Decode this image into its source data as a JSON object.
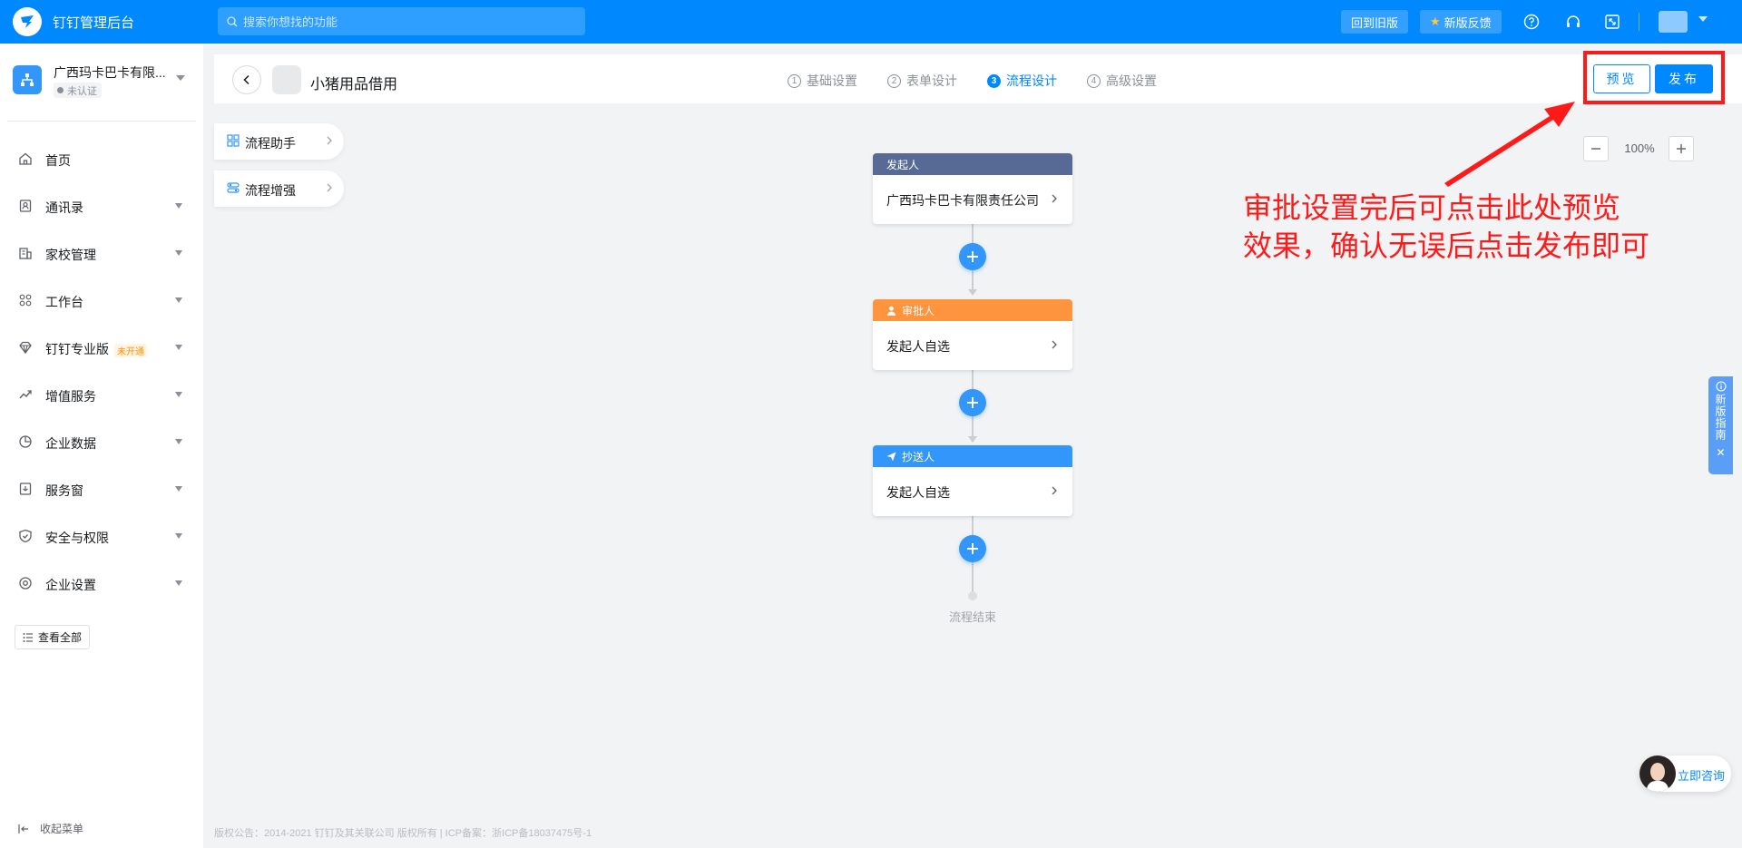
{
  "topbar": {
    "app_title": "钉钉管理后台",
    "search_placeholder": "搜索你想找的功能",
    "old_version_label": "回到旧版",
    "feedback_label": "新版反馈",
    "icons": [
      "help-icon",
      "headset-icon",
      "fullscreen-icon"
    ],
    "brand_color": "#0089ff"
  },
  "sidebar": {
    "org_name": "广西玛卡巴卡有限...",
    "org_status": "未认证",
    "items": [
      {
        "label": "首页",
        "icon": "home-icon",
        "has_caret": false
      },
      {
        "label": "通讯录",
        "icon": "contacts-icon",
        "has_caret": true
      },
      {
        "label": "家校管理",
        "icon": "school-icon",
        "has_caret": true
      },
      {
        "label": "工作台",
        "icon": "apps-icon",
        "has_caret": true
      },
      {
        "label": "钉钉专业版",
        "icon": "diamond-icon",
        "has_caret": true,
        "tag": "未开通"
      },
      {
        "label": "增值服务",
        "icon": "trend-icon",
        "has_caret": true
      },
      {
        "label": "企业数据",
        "icon": "chart-icon",
        "has_caret": true
      },
      {
        "label": "服务窗",
        "icon": "service-icon",
        "has_caret": true
      },
      {
        "label": "安全与权限",
        "icon": "shield-icon",
        "has_caret": true
      },
      {
        "label": "企业设置",
        "icon": "settings-icon",
        "has_caret": true
      }
    ],
    "view_all_label": "查看全部",
    "collapse_label": "收起菜单"
  },
  "header": {
    "form_title": "小猪用品借用",
    "steps": [
      {
        "num": "1",
        "label": "基础设置",
        "active": false
      },
      {
        "num": "2",
        "label": "表单设计",
        "active": false
      },
      {
        "num": "3",
        "label": "流程设计",
        "active": true
      },
      {
        "num": "4",
        "label": "高级设置",
        "active": false
      }
    ],
    "preview_label": "预览",
    "publish_label": "发布"
  },
  "helpers": [
    {
      "label": "流程助手",
      "icon": "grid-icon"
    },
    {
      "label": "流程增强",
      "icon": "toggle-icon"
    }
  ],
  "zoom": {
    "value": "100%"
  },
  "flow": {
    "nodes": [
      {
        "type": "initiator",
        "title": "发起人",
        "content": "广西玛卡巴卡有限责任公司",
        "color": "#576a95"
      },
      {
        "type": "approver",
        "title": "审批人",
        "content": "发起人自选",
        "color": "#ff943e"
      },
      {
        "type": "cc",
        "title": "抄送人",
        "content": "发起人自选",
        "color": "#3296fa"
      }
    ],
    "end_label": "流程结束"
  },
  "annotation": {
    "line1": "审批设置完后可点击此处预览",
    "line2": "效果，确认无误后点击发布即可",
    "color": "#ff1a1a"
  },
  "guide": {
    "label": "新版指南"
  },
  "consult": {
    "label": "立即咨询"
  },
  "footer": {
    "text": "版权公告：2014-2021 钉钉及其关联公司 版权所有 | ICP备案：浙ICP备18037475号-1"
  }
}
